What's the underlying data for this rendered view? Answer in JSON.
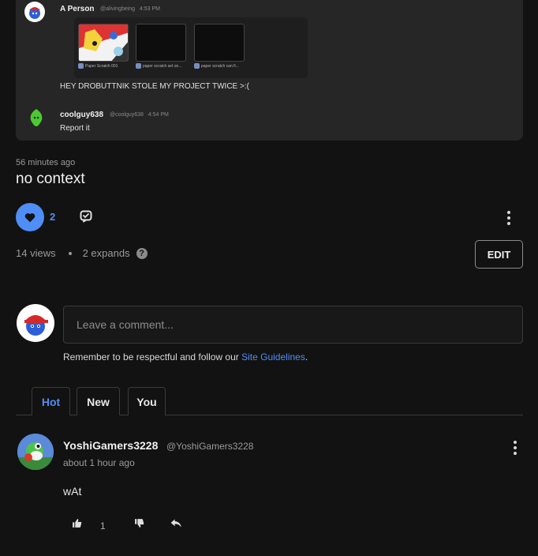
{
  "embedded_chat": {
    "msg1": {
      "name": "A Person",
      "handle": "@alivingbeing",
      "time": "4:53 PM",
      "text": "HEY DROBUTTNIK STOLE MY PROJECT TWICE >:("
    },
    "thumbs": [
      {
        "caption": "Paper Scratch 001"
      },
      {
        "caption": "paper scratch set on..."
      },
      {
        "caption": "paper scratch can fi..."
      }
    ],
    "msg2": {
      "name": "coolguy638",
      "handle": "@coolguy638",
      "time": "4:54 PM",
      "text": "Report it"
    }
  },
  "post": {
    "time_ago": "56 minutes ago",
    "title": "no context",
    "likes": "2",
    "views": "14 views",
    "expands": "2 expands",
    "edit_label": "EDIT"
  },
  "comment_box": {
    "placeholder": "Leave a comment...",
    "guidelines_prefix": "Remember to be respectful and follow our ",
    "guidelines_link": "Site Guidelines",
    "guidelines_suffix": "."
  },
  "tabs": [
    {
      "label": "Hot",
      "active": true
    },
    {
      "label": "New",
      "active": false
    },
    {
      "label": "You",
      "active": false
    }
  ],
  "comments": [
    {
      "author": "YoshiGamers3228",
      "handle": "@YoshiGamers3228",
      "time": "about 1 hour ago",
      "body": "wAt",
      "upvotes": "1"
    }
  ],
  "colors": {
    "accent": "#4f8ef7",
    "background": "#121212",
    "embed_bg": "#262626"
  }
}
